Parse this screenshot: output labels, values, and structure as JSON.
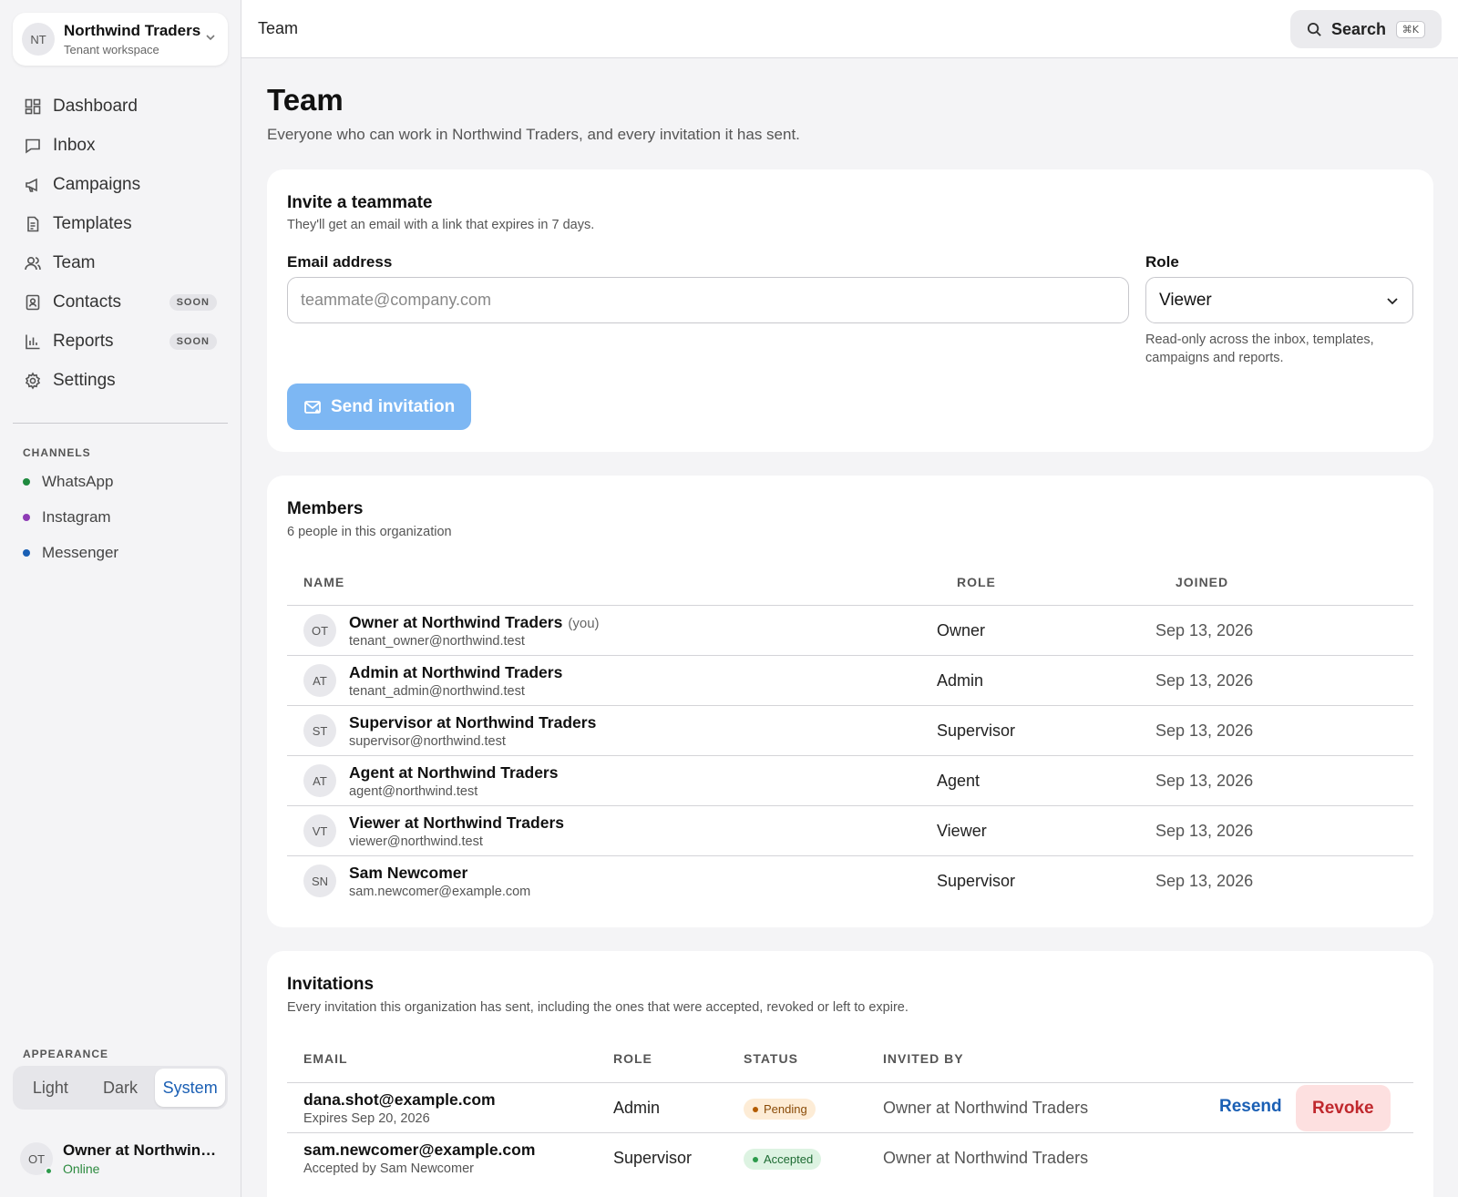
{
  "workspace": {
    "initials": "NT",
    "name": "Northwind Traders",
    "subtitle": "Tenant workspace"
  },
  "nav": [
    {
      "label": "Dashboard",
      "icon": "dashboard-icon"
    },
    {
      "label": "Inbox",
      "icon": "inbox-icon"
    },
    {
      "label": "Campaigns",
      "icon": "megaphone-icon"
    },
    {
      "label": "Templates",
      "icon": "document-icon"
    },
    {
      "label": "Team",
      "icon": "users-icon"
    },
    {
      "label": "Contacts",
      "icon": "contacts-icon",
      "badge": "SOON"
    },
    {
      "label": "Reports",
      "icon": "bar-chart-icon",
      "badge": "SOON"
    },
    {
      "label": "Settings",
      "icon": "gear-icon"
    }
  ],
  "channels": {
    "heading": "CHANNELS",
    "items": [
      {
        "label": "WhatsApp",
        "color": "#1f8a3f"
      },
      {
        "label": "Instagram",
        "color": "#8e3bb5"
      },
      {
        "label": "Messenger",
        "color": "#1a5fb4"
      }
    ]
  },
  "appearance": {
    "heading": "APPEARANCE",
    "options": [
      "Light",
      "Dark",
      "System"
    ],
    "selected": "System"
  },
  "user": {
    "initials": "OT",
    "name": "Owner at Northwind Traders",
    "status": "Online"
  },
  "topbar": {
    "title": "Team",
    "search_label": "Search",
    "shortcut": "⌘K"
  },
  "page": {
    "title": "Team",
    "subtitle": "Everyone who can work in Northwind Traders, and every invitation it has sent."
  },
  "invite": {
    "title": "Invite a teammate",
    "subtitle": "They'll get an email with a link that expires in 7 days.",
    "email_label": "Email address",
    "email_placeholder": "teammate@company.com",
    "email_value": "",
    "role_label": "Role",
    "role_value": "Viewer",
    "role_hint": "Read-only across the inbox, templates, campaigns and reports.",
    "submit_label": "Send invitation"
  },
  "members": {
    "title": "Members",
    "subtitle": "6 people in this organization",
    "columns": [
      "NAME",
      "ROLE",
      "JOINED"
    ],
    "you_label": "(you)",
    "rows": [
      {
        "initials": "OT",
        "name": "Owner at Northwind Traders",
        "is_you": true,
        "email": "tenant_owner@northwind.test",
        "role": "Owner",
        "joined": "Sep 13, 2026"
      },
      {
        "initials": "AT",
        "name": "Admin at Northwind Traders",
        "email": "tenant_admin@northwind.test",
        "role": "Admin",
        "joined": "Sep 13, 2026"
      },
      {
        "initials": "ST",
        "name": "Supervisor at Northwind Traders",
        "email": "supervisor@northwind.test",
        "role": "Supervisor",
        "joined": "Sep 13, 2026"
      },
      {
        "initials": "AT",
        "name": "Agent at Northwind Traders",
        "email": "agent@northwind.test",
        "role": "Agent",
        "joined": "Sep 13, 2026"
      },
      {
        "initials": "VT",
        "name": "Viewer at Northwind Traders",
        "email": "viewer@northwind.test",
        "role": "Viewer",
        "joined": "Sep 13, 2026"
      },
      {
        "initials": "SN",
        "name": "Sam Newcomer",
        "email": "sam.newcomer@example.com",
        "role": "Supervisor",
        "joined": "Sep 13, 2026"
      }
    ]
  },
  "invitations": {
    "title": "Invitations",
    "subtitle": "Every invitation this organization has sent, including the ones that were accepted, revoked or left to expire.",
    "columns": [
      "EMAIL",
      "ROLE",
      "STATUS",
      "INVITED BY"
    ],
    "rows": [
      {
        "email": "dana.shot@example.com",
        "detail": "Expires Sep 20, 2026",
        "role": "Admin",
        "status": "Pending",
        "invited_by": "Owner at Northwind Traders",
        "resend_label": "Resend",
        "revoke_label": "Revoke"
      },
      {
        "email": "sam.newcomer@example.com",
        "detail": "Accepted by Sam Newcomer",
        "role": "Supervisor",
        "status": "Accepted",
        "invited_by": "Owner at Northwind Traders"
      }
    ]
  }
}
